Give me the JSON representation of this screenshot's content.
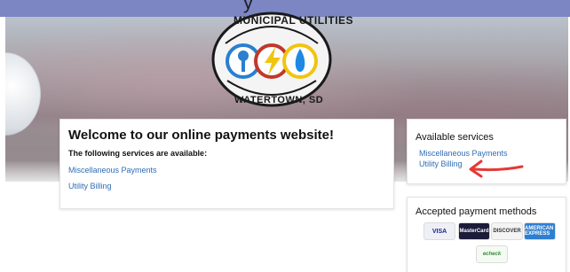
{
  "header": {
    "title_fragment": "y"
  },
  "hero": {
    "logo_top": "MUNICIPAL UTILITIES",
    "logo_bottom": "WATERTOWN, SD",
    "logo_colors": [
      "#2a7fcf",
      "#c0392b",
      "#1e88e5"
    ]
  },
  "welcome": {
    "title": "Welcome to our online payments website!",
    "subtitle": "The following services are available:",
    "links": [
      "Miscellaneous Payments",
      "Utility Billing"
    ]
  },
  "services": {
    "heading": "Available services",
    "links": [
      "Miscellaneous Payments",
      "Utility Billing"
    ]
  },
  "payments": {
    "heading": "Accepted payment methods",
    "methods": [
      "VISA",
      "MasterCard",
      "DISCOVER",
      "AMERICAN EXPRESS",
      "echeck"
    ]
  },
  "colors": {
    "accent_bar": "#7b86c3",
    "link": "#2f6db5",
    "arrow": "#e53935"
  }
}
